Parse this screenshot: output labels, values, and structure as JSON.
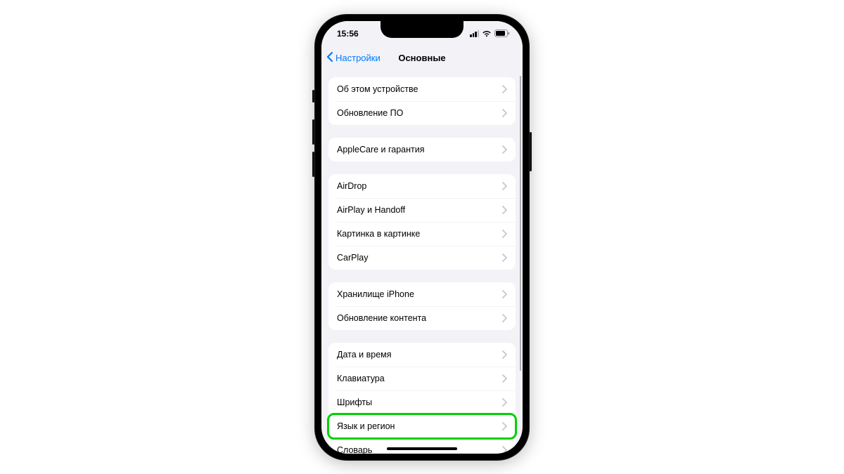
{
  "status": {
    "time": "15:56"
  },
  "nav": {
    "back": "Настройки",
    "title": "Основные"
  },
  "groups": [
    {
      "rows": [
        "Об этом устройстве",
        "Обновление ПО"
      ]
    },
    {
      "rows": [
        "AppleCare и гарантия"
      ]
    },
    {
      "rows": [
        "AirDrop",
        "AirPlay и Handoff",
        "Картинка в картинке",
        "CarPlay"
      ]
    },
    {
      "rows": [
        "Хранилище iPhone",
        "Обновление контента"
      ]
    },
    {
      "rows": [
        "Дата и время",
        "Клавиатура",
        "Шрифты",
        "Язык и регион",
        "Словарь"
      ]
    }
  ],
  "highlighted": "Язык и регион"
}
